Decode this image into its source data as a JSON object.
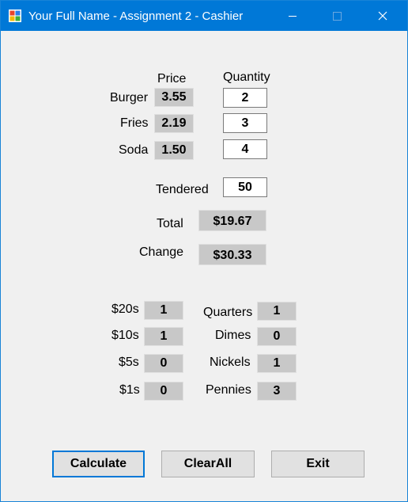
{
  "window": {
    "title": "Your Full Name - Assignment 2 - Cashier",
    "icon": "windows-form-icon",
    "controls": [
      "minimize-icon",
      "maximize-icon",
      "close-icon"
    ]
  },
  "order": {
    "price_header": "Price",
    "quantity_header": "Quantity",
    "items": [
      {
        "label": "Burger",
        "price": "3.55",
        "quantity": "2"
      },
      {
        "label": "Fries",
        "price": "2.19",
        "quantity": "3"
      },
      {
        "label": "Soda",
        "price": "1.50",
        "quantity": "4"
      }
    ],
    "tendered_label": "Tendered",
    "tendered_value": "50",
    "total_label": "Total",
    "total_value": "$19.67",
    "change_label": "Change",
    "change_value": "$30.33"
  },
  "bills": [
    {
      "label": "$20s",
      "count": "1"
    },
    {
      "label": "$10s",
      "count": "1"
    },
    {
      "label": "$5s",
      "count": "0"
    },
    {
      "label": "$1s",
      "count": "0"
    }
  ],
  "coins": [
    {
      "label": "Quarters",
      "count": "1"
    },
    {
      "label": "Dimes",
      "count": "0"
    },
    {
      "label": "Nickels",
      "count": "1"
    },
    {
      "label": "Pennies",
      "count": "3"
    }
  ],
  "buttons": {
    "calculate": "Calculate",
    "clear_all": "ClearAll",
    "exit": "Exit"
  },
  "colors": {
    "titlebar": "#0078d7",
    "form_background": "#f0f0f0",
    "readonly_box": "#c8c8c8",
    "default_button_border": "#0078d7"
  }
}
